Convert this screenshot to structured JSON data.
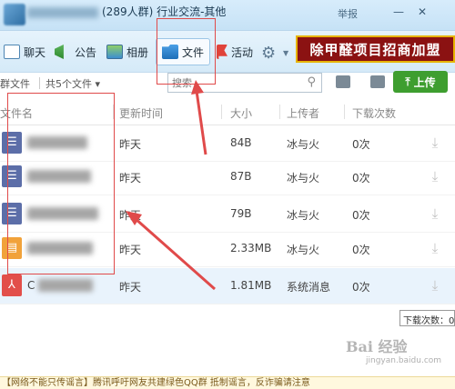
{
  "window": {
    "group_name": "(289人群) 行业交流-其他",
    "report": "举报",
    "minimize": "—",
    "close": "✕"
  },
  "tabs": [
    {
      "label": "聊天",
      "icon": "chat-icon"
    },
    {
      "label": "公告",
      "icon": "notice-icon"
    },
    {
      "label": "相册",
      "icon": "album-icon"
    },
    {
      "label": "文件",
      "icon": "folder-icon",
      "active": true
    },
    {
      "label": "活动",
      "icon": "flag-icon"
    }
  ],
  "banner": {
    "text": "除甲醛项目招商加盟"
  },
  "toolbar": {
    "group_files": "群文件",
    "count": "共5个文件",
    "search_placeholder": "搜索",
    "upload": "上传"
  },
  "table": {
    "headers": [
      "文件名",
      "更新时间",
      "大小",
      "上传者",
      "下载次数"
    ],
    "rows": [
      {
        "type": "doc",
        "time": "昨天",
        "size": "84B",
        "uploader": "冰与火",
        "downloads": "0次"
      },
      {
        "type": "doc",
        "time": "昨天",
        "size": "87B",
        "uploader": "冰与火",
        "downloads": "0次"
      },
      {
        "type": "doc",
        "time": "昨天",
        "size": "79B",
        "uploader": "冰与火",
        "downloads": "0次"
      },
      {
        "type": "zip",
        "time": "昨天",
        "size": "2.33MB",
        "uploader": "冰与火",
        "downloads": "0次"
      },
      {
        "type": "pdf",
        "name_prefix": "C",
        "time": "昨天",
        "size": "1.81MB",
        "uploader": "系统消息",
        "downloads": "0次"
      }
    ]
  },
  "tooltip": "下载次数：0",
  "bottom": {
    "text": "【网络不能只传谣言】腾讯呼吁网友共建绿色QQ群 抵制谣言，反诈骗请注意"
  },
  "watermark": {
    "brand": "Bai 经验",
    "url": "jingyan.baidu.com"
  },
  "colors": {
    "accent": "#1f6fb8",
    "upload_green": "#3e9e2f",
    "annotation_red": "#e04a4a"
  }
}
